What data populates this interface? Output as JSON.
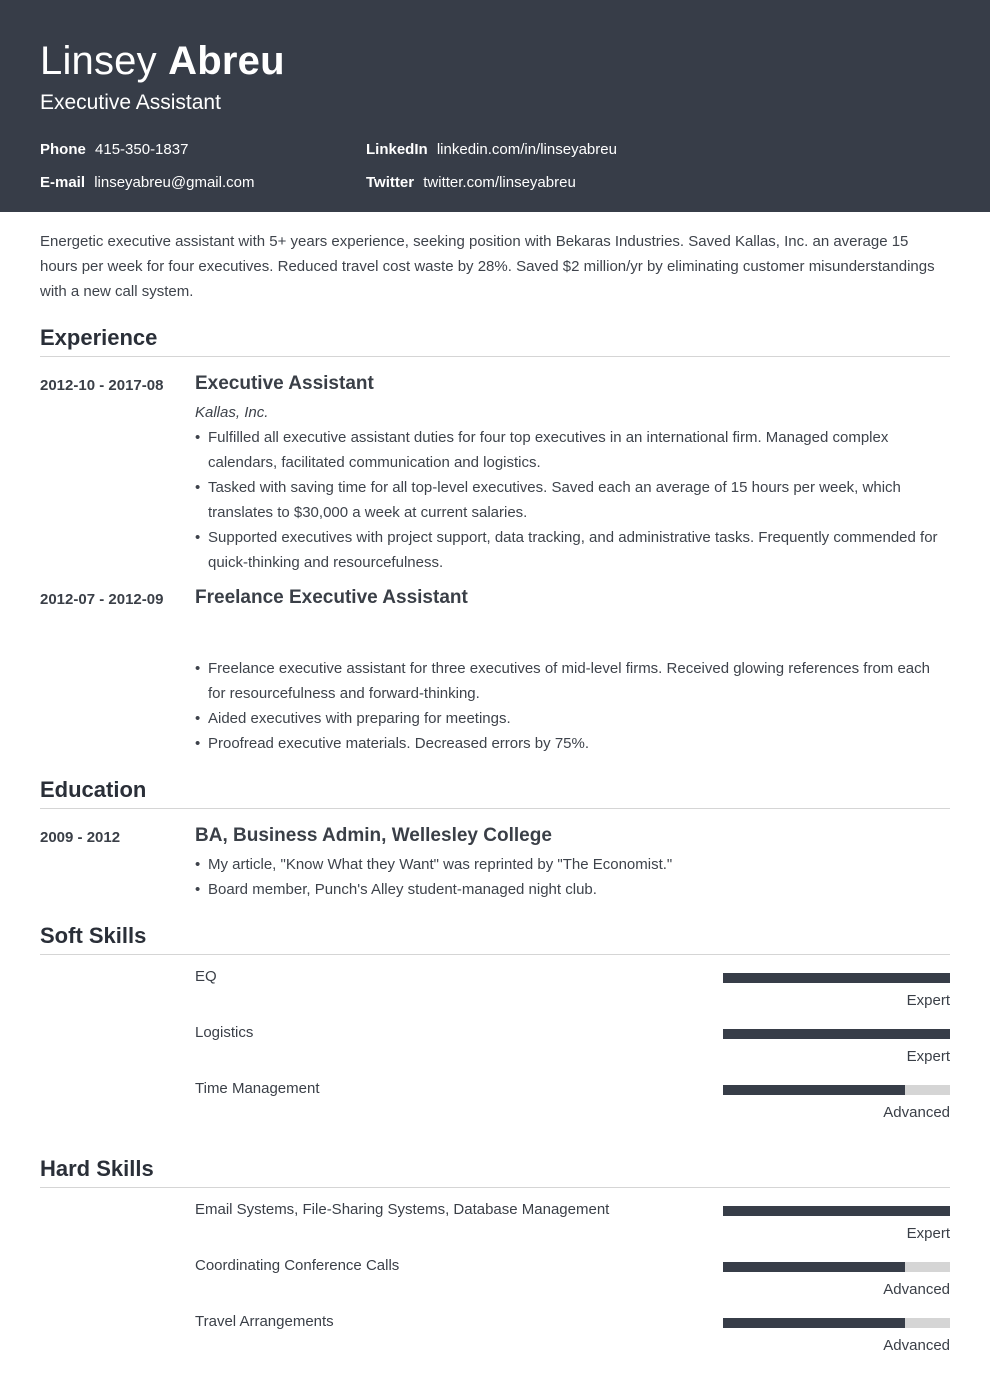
{
  "header": {
    "first_name": "Linsey",
    "last_name": "Abreu",
    "role": "Executive Assistant",
    "contacts": [
      {
        "label": "Phone",
        "value": "415-350-1837"
      },
      {
        "label": "LinkedIn",
        "value": "linkedin.com/in/linseyabreu"
      },
      {
        "label": "E-mail",
        "value": "linseyabreu@gmail.com"
      },
      {
        "label": "Twitter",
        "value": "twitter.com/linseyabreu"
      }
    ]
  },
  "summary": "Energetic executive assistant with 5+ years experience, seeking position with Bekaras Industries. Saved Kallas, Inc. an average 15 hours per week for four executives. Reduced travel cost waste by 28%. Saved $2 million/yr by eliminating customer misunderstandings with a new call system.",
  "experience": {
    "title": "Experience",
    "entries": [
      {
        "date": "2012-10 - 2017-08",
        "title": "Executive Assistant",
        "company": "Kallas, Inc.",
        "bullets": [
          "Fulfilled all executive assistant duties for four top executives in an international firm. Managed complex calendars, facilitated communication and logistics.",
          "Tasked with saving time for all top-level executives. Saved each an average of 15 hours per week, which translates to $30,000 a week at current salaries.",
          "Supported executives with project support, data tracking, and administrative tasks. Frequently commended for quick-thinking and resourcefulness."
        ]
      },
      {
        "date": "2012-07 - 2012-09",
        "title": "Freelance Executive Assistant",
        "company": "",
        "bullets": [
          "Freelance executive assistant for three executives of mid-level firms. Received glowing references from each for resourcefulness and forward-thinking.",
          "Aided executives with preparing for meetings.",
          "Proofread executive materials. Decreased errors by 75%."
        ]
      }
    ]
  },
  "education": {
    "title": "Education",
    "entries": [
      {
        "date": "2009 - 2012",
        "title": "BA, Business Admin, Wellesley College",
        "bullets": [
          "My article, \"Know What they Want\" was reprinted by \"The Economist.\"",
          "Board member, Punch's Alley student-managed night club."
        ]
      }
    ]
  },
  "soft_skills": {
    "title": "Soft Skills",
    "items": [
      {
        "name": "EQ",
        "level": "Expert",
        "fill_percent": 100
      },
      {
        "name": "Logistics",
        "level": "Expert",
        "fill_percent": 100
      },
      {
        "name": "Time Management",
        "level": "Advanced",
        "fill_percent": 80
      }
    ]
  },
  "hard_skills": {
    "title": "Hard Skills",
    "items": [
      {
        "name": "Email Systems, File-Sharing Systems, Database Management",
        "level": "Expert",
        "fill_percent": 100
      },
      {
        "name": "Coordinating Conference Calls",
        "level": "Advanced",
        "fill_percent": 80
      },
      {
        "name": "Travel Arrangements",
        "level": "Advanced",
        "fill_percent": 80
      }
    ]
  },
  "colors": {
    "header_bg": "#373d48",
    "bar_fill": "#373d48",
    "bar_track": "#d5d5d5"
  }
}
